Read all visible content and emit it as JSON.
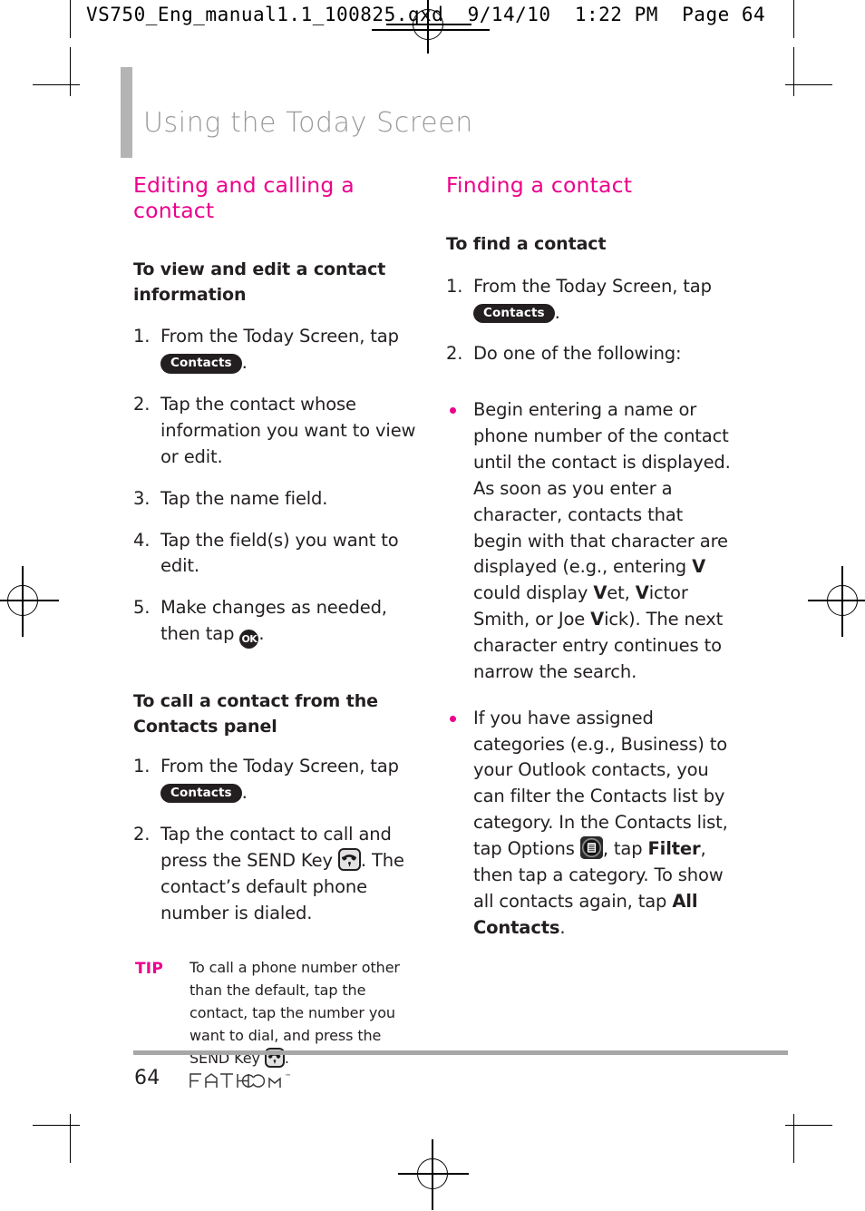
{
  "slug": {
    "text": "VS750_Eng_manual1.1_100825.qxd  9/14/10  1:22 PM  Page 64"
  },
  "page": {
    "title": "Using the Today Screen",
    "number": "64",
    "brand": "FATHOM",
    "brand_tm": "™"
  },
  "colors": {
    "accent_pink": "#ec008c",
    "title_gray": "#9a9a9a",
    "bar_gray": "#b4b4b4",
    "rule_gray": "#a7a7a7",
    "ink": "#231f20",
    "chip_dark": "#231f20",
    "send_key_fill": "#e2e2e2"
  },
  "left_column": {
    "section_heading": "Editing and calling a contact",
    "sub_heading_1": "To view and edit a contact information",
    "steps_1": [
      {
        "num": "1.",
        "pre": "From the Today Screen, tap ",
        "chip": "Contacts",
        "post": "."
      },
      {
        "num": "2.",
        "pre": "Tap the contact whose information you want to view or edit.",
        "chip": null,
        "post": ""
      },
      {
        "num": "3.",
        "pre": "Tap the name field.",
        "chip": null,
        "post": ""
      },
      {
        "num": "4.",
        "pre": "Tap the field(s) you want to edit.",
        "chip": null,
        "post": ""
      },
      {
        "num": "5.",
        "pre": "Make changes as needed, then tap ",
        "chip": "OK",
        "post": "."
      }
    ],
    "sub_heading_2": "To call a contact from the Contacts panel",
    "steps_2": [
      {
        "num": "1.",
        "pre": "From the Today Screen, tap ",
        "chip": "Contacts",
        "post": "."
      },
      {
        "num": "2.",
        "pre": "Tap the contact to call and press the SEND Key ",
        "chip": "send-key",
        "post": ". The contact’s default phone number is dialed."
      }
    ],
    "tip": {
      "label": "TIP",
      "text_1": "To call a phone number other than the default, tap the contact, tap the number you want to dial, and press the SEND Key ",
      "chip": "send-key",
      "text_2": "."
    }
  },
  "right_column": {
    "section_heading": "Finding a contact",
    "sub_heading_1": "To find a contact",
    "steps_1": [
      {
        "num": "1.",
        "pre": "From the Today Screen, tap ",
        "chip": "Contacts",
        "post": "."
      },
      {
        "num": "2.",
        "pre": "Do one of the following:",
        "chip": null,
        "post": ""
      }
    ],
    "bullets": [
      {
        "seg1": "Begin entering a name or phone number of the contact until the contact is displayed. As soon as you enter a character, contacts that begin with that character are displayed (e.g., entering ",
        "bold1": "V",
        "seg2": " could display ",
        "bold2": "V",
        "seg3": "et, ",
        "bold3": "V",
        "seg4": "ictor Smith, or Joe ",
        "bold4": "V",
        "seg5": "ick). The next character entry continues to narrow the search."
      },
      {
        "seg1": "If you have assigned categories (e.g., Business) to your Outlook contacts, you can filter the Contacts list by category. In the Contacts list, tap Options ",
        "chip": "options",
        "seg2": ", tap ",
        "bold1": "Filter",
        "seg3": ", then tap a category. To show all contacts again, tap ",
        "bold2": "All Contacts",
        "seg4": "."
      }
    ]
  },
  "icons": {
    "contacts_chip": "contacts-pill-icon",
    "ok_chip": "ok-button-icon",
    "send_key": "send-key-icon",
    "options": "options-menu-icon"
  }
}
